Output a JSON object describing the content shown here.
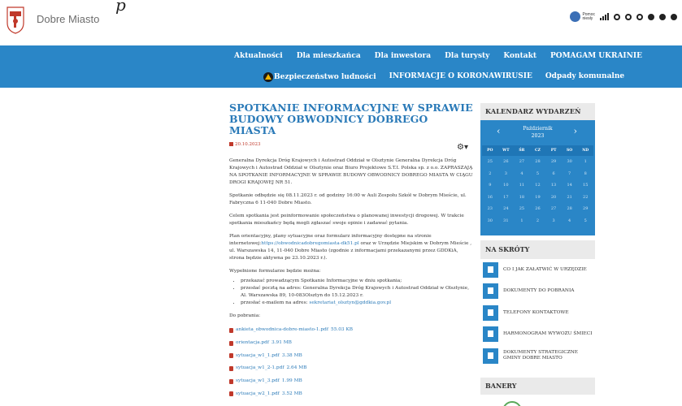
{
  "header": {
    "site_name": "Dobre Miasto",
    "top_italic": "p",
    "accessibility": {
      "deaf_label_1": "Pomoc",
      "deaf_label_2": "niesły"
    }
  },
  "nav": {
    "row1": [
      "Aktualności",
      "Dla mieszkańca",
      "Dla inwestora",
      "Dla turysty",
      "Kontakt",
      "POMAGAM UKRAINIE"
    ],
    "row2": [
      "Bezpieczeństwo ludności",
      "INFORMACJE O KORONAWIRUSIE",
      "Odpady komunalne"
    ]
  },
  "article": {
    "title": "SPOTKANIE INFORMACYJNE W SPRAWIE BUDOWY OBWODNICY DOBREGO MIASTA",
    "date": "20.10.2023",
    "paragraphs": [
      "Generalna Dyrekcja Dróg Krajowych i Autostrad Oddział w Olsztynie Generalna Dyrekcja Dróg Krajowych i Autostrad Oddział w Olsztynie oraz Biuro Projektowe S.T.I. Polska sp. z o.o. ZAPRASZAJĄ NA SPOTKANIE INFORMACYJNE W SPRAWIE BUDOWY OBWODNICY DOBREGO MIASTA W CIĄGU DROGI KRAJOWEJ NR 51.",
      "Spotkanie odbędzie się 08.11.2023 r. od godziny 16:00 w Auli Zespołu Szkół w Dobrym Mieście, ul. Fabryczna 6 11-040 Dobre Miasto.",
      "Celem spotkania jest poinformowanie społeczeństwa o planowanej inwestycji drogowej. W trakcie spotkania mieszkańcy będą mogli zgłaszać swoje opinie i zadawać pytania."
    ],
    "p4_before": "Plan orientacyjny, plany sytuacyjne oraz formularz informacyjny dostępne na stronie internetowej:",
    "p4_link": "https://obwodnicadobregomiasta-dk51.pl",
    "p4_after": " oraz w Urzędzie Miejskim w Dobrym Mieście , ul. Warszawska 14, 11-040 Dobre Miasto (zgodnie z informacjami przekazanymi przez GDDKiA, strona będzie aktywna po 23.10.2023 r.).",
    "forms_intro": "Wypełnione formularze będzie można:",
    "bullets": [
      "przekazać prowadzącym Spotkanie Informacyjne w dniu spotkania;",
      "przesłać pocztą na adres: Generalna Dyrekcja Dróg Krajowych i Autostrad Oddział w Olsztynie, Al. Warszawska 89, 10-083Olsztyn do 15.12.2023 r."
    ],
    "bullet3_before": "przesłać e-mailem na adres: ",
    "bullet3_link": "sekretariat_olsztyn@gddkia.gov.pl",
    "downloads_label": "Do pobrania:",
    "files": [
      {
        "name": "ankieta_obwodnica-dobre-miasto-1.pdf",
        "size": "55.03 KB"
      },
      {
        "name": "orientacja.pdf",
        "size": "3.91 MB"
      },
      {
        "name": "sytuacja_w1_1.pdf",
        "size": "3.38 MB"
      },
      {
        "name": "sytuacja_w1_2-1.pdf",
        "size": "2.64 MB"
      },
      {
        "name": "sytuacja_w1_3.pdf",
        "size": "1.99 MB"
      },
      {
        "name": "sytuacja_w2_1.pdf",
        "size": "3.52 MB"
      }
    ]
  },
  "calendar": {
    "heading": "KALENDARZ WYDARZEŃ",
    "month": "Październik",
    "year": "2023",
    "prev": "‹",
    "next": "›",
    "day_names": [
      "PO",
      "WT",
      "ŚR",
      "CZ",
      "PT",
      "SO",
      "ND"
    ],
    "days": [
      "25",
      "26",
      "27",
      "28",
      "29",
      "30",
      "1",
      "2",
      "3",
      "4",
      "5",
      "6",
      "7",
      "8",
      "9",
      "10",
      "11",
      "12",
      "13",
      "14",
      "15",
      "16",
      "17",
      "18",
      "19",
      "20",
      "21",
      "22",
      "23",
      "24",
      "25",
      "26",
      "27",
      "28",
      "29",
      "30",
      "31",
      "1",
      "2",
      "3",
      "4",
      "5"
    ]
  },
  "shortcuts": {
    "heading": "NA SKRÓTY",
    "items": [
      {
        "label": "CO I JAK ZAŁATWIĆ W URZĘDZIE",
        "icon": "person-icon"
      },
      {
        "label": "DOKUMENTY DO POBRANIA",
        "icon": "document-download-icon"
      },
      {
        "label": "TELEFONY KONTAKTOWE",
        "icon": "phone-icon"
      },
      {
        "label": "HARMONOGRAM WYWOZU ŚMIECI",
        "icon": "truck-icon"
      },
      {
        "label": "DOKUMENTY STRATEGICZNE GMINY DOBRE MIASTO",
        "icon": "document-icon"
      }
    ]
  },
  "banners": {
    "heading": "BANERY"
  },
  "colors": {
    "nav_bg": "#2a86c7",
    "title": "#2a7ab8",
    "accent_red": "#c0392b"
  }
}
